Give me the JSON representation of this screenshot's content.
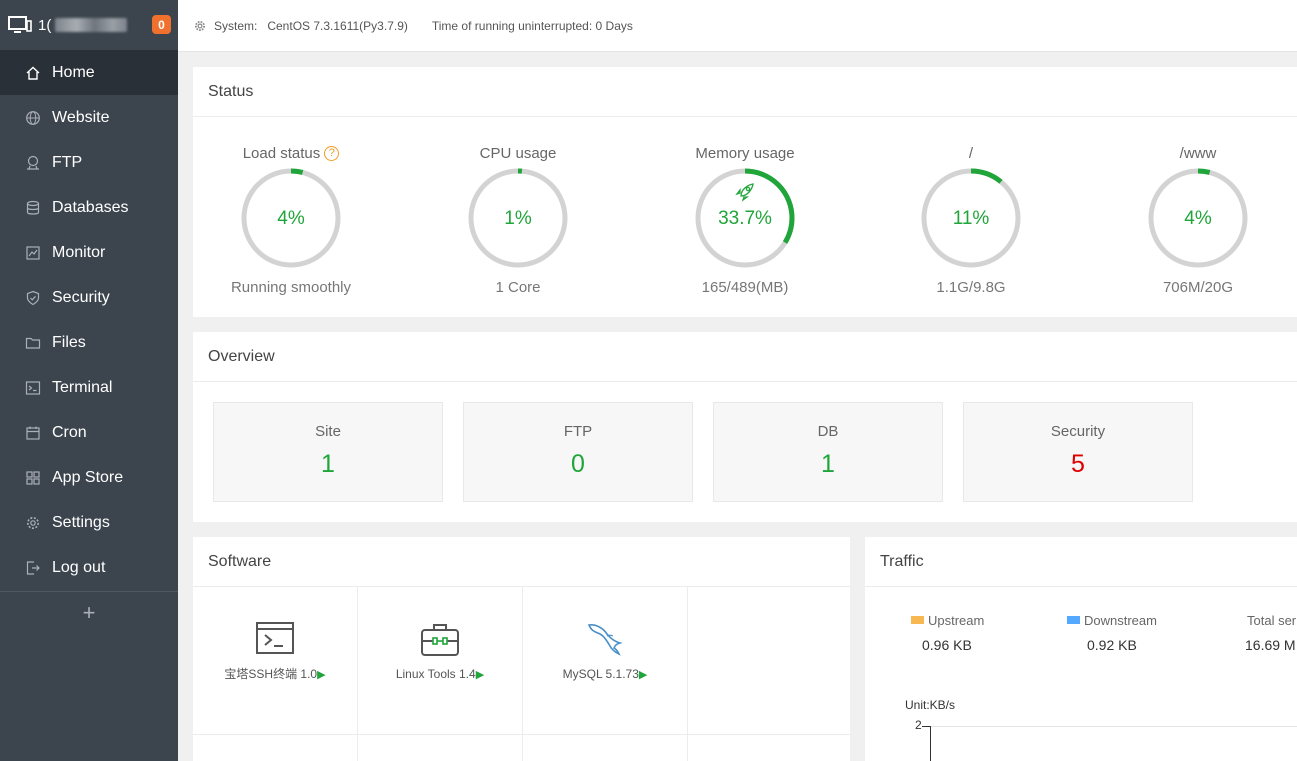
{
  "header": {
    "host_prefix": "1(",
    "badge": "0"
  },
  "sidebar": {
    "items": [
      {
        "label": "Home",
        "icon": "home-icon"
      },
      {
        "label": "Website",
        "icon": "globe-icon"
      },
      {
        "label": "FTP",
        "icon": "ftp-icon"
      },
      {
        "label": "Databases",
        "icon": "database-icon"
      },
      {
        "label": "Monitor",
        "icon": "monitor-icon"
      },
      {
        "label": "Security",
        "icon": "shield-icon"
      },
      {
        "label": "Files",
        "icon": "folder-icon"
      },
      {
        "label": "Terminal",
        "icon": "terminal-icon"
      },
      {
        "label": "Cron",
        "icon": "calendar-icon"
      },
      {
        "label": "App Store",
        "icon": "grid-icon"
      },
      {
        "label": "Settings",
        "icon": "gear-icon"
      },
      {
        "label": "Log out",
        "icon": "logout-icon"
      }
    ],
    "plus": "+"
  },
  "topbar": {
    "system_label": "System:",
    "system_value": "CentOS 7.3.1611(Py3.7.9)",
    "uptime": "Time of running uninterrupted: 0 Days"
  },
  "status": {
    "title": "Status",
    "gauges": [
      {
        "label": "Load status",
        "value": "4%",
        "percent": 4,
        "sub": "Running smoothly",
        "help": "?"
      },
      {
        "label": "CPU usage",
        "value": "1%",
        "percent": 1,
        "sub": "1 Core"
      },
      {
        "label": "Memory usage",
        "value": "33.7%",
        "percent": 33.7,
        "sub": "165/489(MB)"
      },
      {
        "label": "/",
        "value": "11%",
        "percent": 11,
        "sub": "1.1G/9.8G"
      },
      {
        "label": "/www",
        "value": "4%",
        "percent": 4,
        "sub": "706M/20G"
      }
    ]
  },
  "overview": {
    "title": "Overview",
    "boxes": [
      {
        "name": "Site",
        "value": "1"
      },
      {
        "name": "FTP",
        "value": "0"
      },
      {
        "name": "DB",
        "value": "1"
      },
      {
        "name": "Security",
        "value": "5"
      }
    ]
  },
  "software": {
    "title": "Software",
    "items": [
      {
        "name": "宝塔SSH终端 1.0",
        "icon": "terminal-window-icon"
      },
      {
        "name": "Linux Tools 1.4",
        "icon": "toolbox-icon"
      },
      {
        "name": "MySQL 5.1.73",
        "icon": "mysql-dolphin-icon"
      }
    ],
    "play": "▶"
  },
  "traffic": {
    "title": "Traffic",
    "upstream_label": "Upstream",
    "upstream_value": "0.96 KB",
    "downstream_label": "Downstream",
    "downstream_value": "0.92 KB",
    "total_label": "Total ser",
    "total_value": "16.69 M",
    "unit": "Unit:KB/s",
    "axis_max": "2",
    "upstream_color": "#f7b851",
    "downstream_color": "#52a9ff"
  },
  "colors": {
    "accent": "#20a53a",
    "danger": "#dd0000",
    "sidebar": "#3c444d"
  }
}
